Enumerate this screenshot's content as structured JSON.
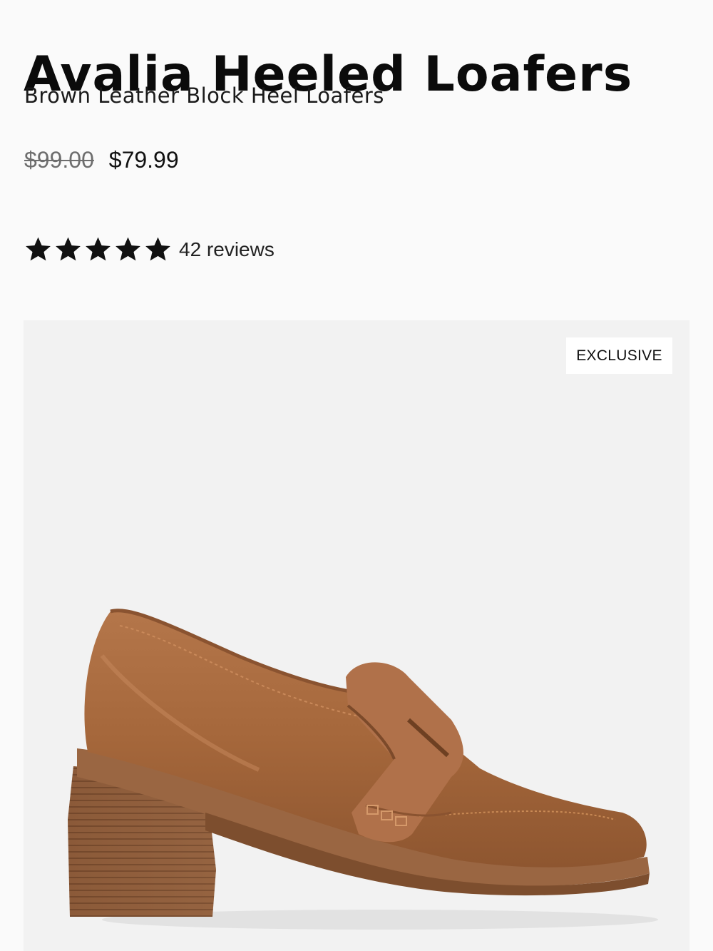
{
  "product": {
    "title": "Avalia Heeled Loafers",
    "subtitle": "Brown Leather Block Heel Loafers",
    "price_original": "$99.00",
    "price_sale": "$79.99",
    "rating": 5,
    "reviews_label": "42 reviews",
    "badge": "EXCLUSIVE",
    "image_subject": "brown-leather-block-heel-loafer"
  },
  "colors": {
    "background": "#fafafa",
    "image_bg": "#f2f2f2",
    "leather": "#a8693e",
    "heel_wood": "#8a5a3a",
    "star": "#111111"
  }
}
